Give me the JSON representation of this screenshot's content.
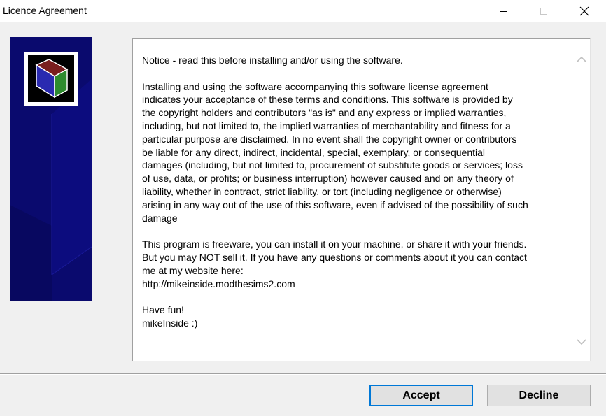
{
  "window": {
    "title": "Licence Agreement"
  },
  "license": {
    "paragraphs": [
      "Notice - read this before installing and/or using the software.",
      "Installing and using the software accompanying this software license agreement\nindicates your acceptance of these terms and conditions. This software is provided by\nthe copyright holders and contributors \"as is\" and any express or implied warranties,\nincluding, but not limited to, the implied warranties of merchantability and fitness for a\nparticular purpose are disclaimed. In no event shall the copyright owner or contributors\nbe liable for any direct, indirect, incidental, special, exemplary, or consequential\ndamages (including, but not limited to, procurement of substitute goods or services; loss\nof use, data, or profits; or business interruption) however caused and on any theory of\nliability, whether in contract, strict liability, or tort (including negligence or otherwise)\narising in any way out of the use of this software, even if advised of the possibility of such\ndamage",
      "This program is freeware, you can install it on your machine, or share it with your friends.\nBut you may NOT sell it. If you have any questions or comments about it you can contact\nme at my website here:\nhttp://mikeinside.modthesims2.com",
      "Have fun!\nmikeInside :)"
    ]
  },
  "buttons": {
    "accept": "Accept",
    "decline": "Decline"
  },
  "icons": {
    "minimize": "minimize-icon",
    "maximize": "maximize-icon",
    "close": "close-icon",
    "logo": "box-logo-icon",
    "scroll_up": "chevron-up-icon",
    "scroll_down": "chevron-down-icon"
  },
  "colors": {
    "side_panel": "#0a0a6e",
    "accent": "#0078d7",
    "logo_top": "#7a1e1e",
    "logo_front": "#2a2ab0",
    "logo_side": "#2e8b2e"
  }
}
